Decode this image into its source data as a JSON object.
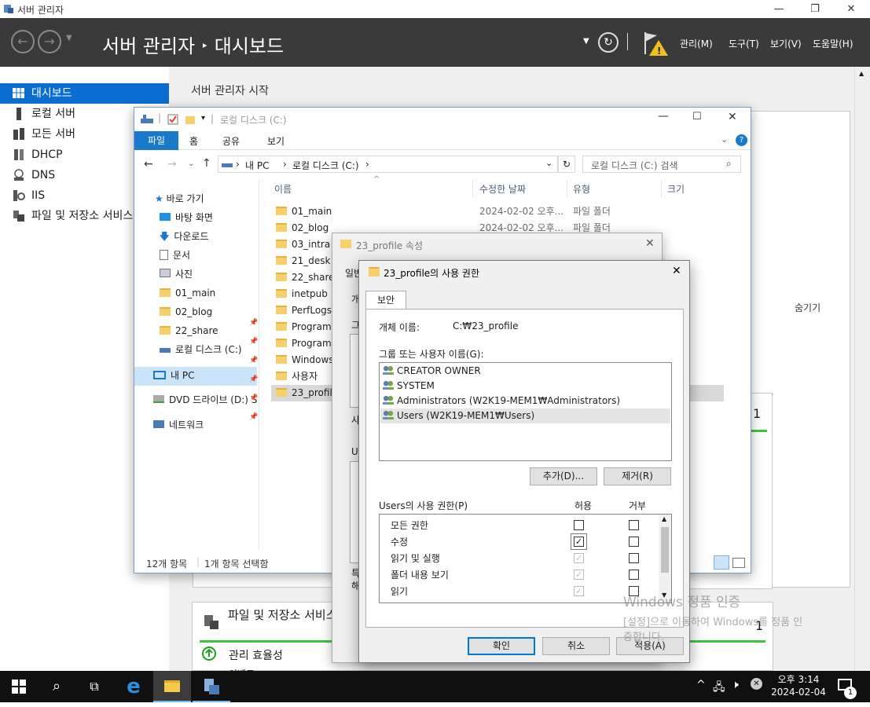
{
  "server_manager": {
    "window_title": "서버 관리자",
    "breadcrumb_root": "서버 관리자",
    "breadcrumb_separator": "‣",
    "breadcrumb_page": "대시보드",
    "menus": [
      "관리(M)",
      "도구(T)",
      "보기(V)",
      "도움말(H)"
    ],
    "sidebar": [
      {
        "label": "대시보드",
        "icon": "dashboard-icon"
      },
      {
        "label": "로컬 서버",
        "icon": "server-icon"
      },
      {
        "label": "모든 서버",
        "icon": "servers-icon"
      },
      {
        "label": "DHCP",
        "icon": "dhcp-icon"
      },
      {
        "label": "DNS",
        "icon": "dns-icon"
      },
      {
        "label": "IIS",
        "icon": "iis-icon"
      },
      {
        "label": "파일 및 저장소 서비스",
        "icon": "storage-icon"
      }
    ],
    "welcome_title": "서버 관리자 시작",
    "hide_link": "숨기기",
    "tile_file_storage": "파일 및 저장소 서비스",
    "tile_count": "1",
    "tile_count_2": "1",
    "manageability": "관리 효율성",
    "tile_bottom_cut": "이벤트"
  },
  "explorer": {
    "title": "로컬 디스크 (C:)",
    "ribbon_tabs": [
      "파일",
      "홈",
      "공유",
      "보기"
    ],
    "address": [
      "내 PC",
      "로컬 디스크 (C:)"
    ],
    "search_placeholder": "로컬 디스크 (C:) 검색",
    "nav": [
      {
        "label": "바로 가기",
        "icon": "star-icon"
      },
      {
        "label": "바탕 화면",
        "icon": "desktop-icon"
      },
      {
        "label": "다운로드",
        "icon": "download-icon"
      },
      {
        "label": "문서",
        "icon": "document-icon"
      },
      {
        "label": "사진",
        "icon": "picture-icon"
      },
      {
        "label": "01_main",
        "icon": "folder-icon"
      },
      {
        "label": "02_blog",
        "icon": "folder-icon"
      },
      {
        "label": "22_share",
        "icon": "folder-icon"
      },
      {
        "label": "로컬 디스크 (C:)",
        "icon": "drive-icon"
      },
      {
        "label": "내 PC",
        "icon": "pc-icon"
      },
      {
        "label": "DVD 드라이브 (D:) S",
        "icon": "dvd-icon"
      },
      {
        "label": "네트워크",
        "icon": "network-icon"
      }
    ],
    "columns": [
      "이름",
      "수정한 날짜",
      "유형",
      "크기"
    ],
    "files": [
      {
        "name": "01_main",
        "date": "2024-02-02 오후...",
        "type": "파일 폴더"
      },
      {
        "name": "02_blog",
        "date": "2024-02-02 오후...",
        "type": "파일 폴더"
      },
      {
        "name": "03_intra"
      },
      {
        "name": "21_desk"
      },
      {
        "name": "22_share"
      },
      {
        "name": "inetpub"
      },
      {
        "name": "PerfLogs"
      },
      {
        "name": "Program F"
      },
      {
        "name": "Program F"
      },
      {
        "name": "Windows"
      },
      {
        "name": "사용자"
      },
      {
        "name": "23_profile"
      }
    ],
    "status_count": "12개 항목",
    "status_selected": "1개 항목 선택함"
  },
  "props_dialog": {
    "title": "23_profile 속성",
    "tab_partial": "일반",
    "side_letters": [
      "개",
      "그",
      "사",
      "Us",
      "특",
      "해"
    ]
  },
  "perm_dialog": {
    "title": "23_profile의 사용 권한",
    "tab": "보안",
    "object_label": "개체 이름:",
    "object_value": "C:₩23_profile",
    "group_label": "그룹 또는 사용자 이름(G):",
    "users": [
      "CREATOR OWNER",
      "SYSTEM",
      "Administrators (W2K19-MEM1₩Administrators)",
      "Users (W2K19-MEM1₩Users)"
    ],
    "add_button": "추가(D)...",
    "remove_button": "제거(R)",
    "perm_label": "Users의 사용 권한(P)",
    "allow_header": "허용",
    "deny_header": "거부",
    "permissions": [
      {
        "name": "모든 권한",
        "allow": "",
        "deny": ""
      },
      {
        "name": "수정",
        "allow": "✓",
        "deny": ""
      },
      {
        "name": "읽기 및 실행",
        "allow": "✓",
        "deny": ""
      },
      {
        "name": "폴더 내용 보기",
        "allow": "✓",
        "deny": ""
      },
      {
        "name": "읽기",
        "allow": "✓",
        "deny": ""
      }
    ],
    "ok_button": "확인",
    "cancel_button": "취소",
    "apply_button": "적용(A)"
  },
  "watermark": {
    "line1": "Windows 정품 인증",
    "line2": "[설정]으로 이동하여 Windows를 정품 인",
    "line3": "증합니다."
  },
  "taskbar": {
    "time": "오후 3:14",
    "date": "2024-02-04",
    "notification_count": "1"
  }
}
